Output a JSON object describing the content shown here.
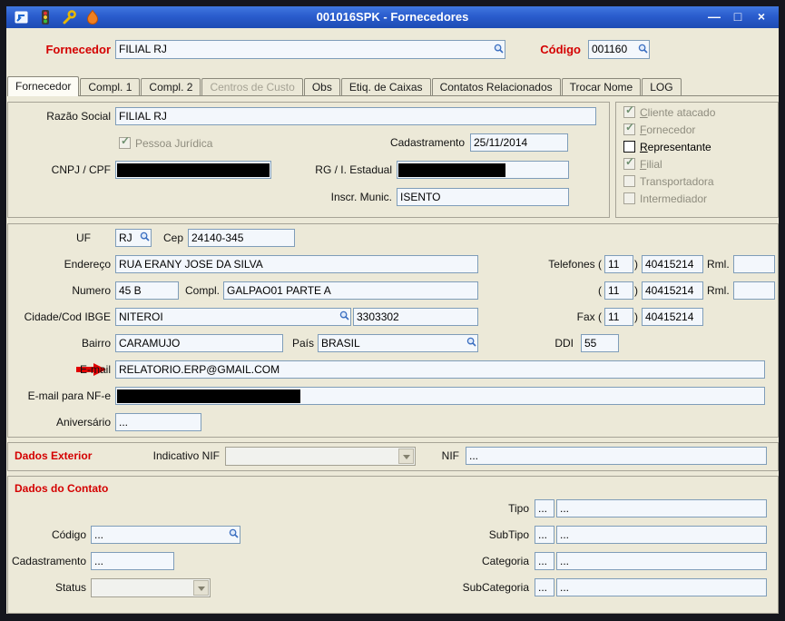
{
  "colors": {
    "titlebar_blue": "#2a5ccd",
    "accent_red": "#d40000",
    "field_bg": "#f3f7fc",
    "window_border": "#15161d",
    "client_bg": "#ece9d8"
  },
  "icons": {
    "titlebar": [
      "export-icon",
      "traffic-light-icon",
      "wrench-icon",
      "flame-icon"
    ],
    "lookup": "magnifier-icon",
    "email_pointer": "red-arrow-icon"
  },
  "window": {
    "title": "001016SPK - Fornecedores",
    "minimize_glyph": "—",
    "maximize_glyph": "□",
    "close_glyph": "×"
  },
  "header": {
    "fornecedor_label": "Fornecedor",
    "fornecedor_value": "FILIAL RJ",
    "codigo_label": "Código",
    "codigo_value": "001160"
  },
  "tabs": [
    "Fornecedor",
    "Compl. 1",
    "Compl. 2",
    "Centros de Custo",
    "Obs",
    "Etiq. de Caixas",
    "Contatos Relacionados",
    "Trocar Nome",
    "LOG"
  ],
  "identificacao": {
    "razao_social_label": "Razão Social",
    "razao_social_value": "FILIAL RJ",
    "pessoa_juridica_label": "Pessoa Jurídica",
    "pessoa_juridica_checked": true,
    "cadastramento_label": "Cadastramento",
    "cadastramento_value": "25/11/2014",
    "cnpj_label": "CNPJ / CPF",
    "cnpj_value_redacted": true,
    "rg_label": "RG / I. Estadual",
    "rg_value_redacted": true,
    "inscr_munic_label": "Inscr. Munic.",
    "inscr_munic_value": "ISENTO"
  },
  "flags": [
    {
      "label": "Cliente atacado",
      "checked": true,
      "enabled": false
    },
    {
      "label": "Fornecedor",
      "checked": true,
      "enabled": false
    },
    {
      "label": "Representante",
      "checked": false,
      "enabled": true
    },
    {
      "label": "Filial",
      "checked": true,
      "enabled": false
    },
    {
      "label": "Transportadora",
      "checked": false,
      "enabled": false
    },
    {
      "label": "Intermediador",
      "checked": false,
      "enabled": false
    }
  ],
  "endereco": {
    "uf_label": "UF",
    "uf_value": "RJ",
    "cep_label": "Cep",
    "cep_value": "24140-345",
    "endereco_label": "Endereço",
    "endereco_value": "RUA ERANY JOSE DA SILVA",
    "telefones_label": "Telefones (",
    "open_paren": "(",
    "close_paren": ")",
    "tel1_ddd": "11",
    "tel1_numero": "40415214",
    "tel1_rml_label": "Rml.",
    "tel1_rml_value": "",
    "tel2_ddd": "11",
    "tel2_numero": "40415214",
    "tel2_rml_label": "Rml.",
    "tel2_rml_value": "",
    "numero_label": "Numero",
    "numero_value": "45 B",
    "compl_label": "Compl.",
    "compl_value": "GALPAO01 PARTE A",
    "cidade_label": "Cidade/Cod IBGE",
    "cidade_value": "NITEROI",
    "cod_ibge_value": "3303302",
    "fax_label": "Fax (",
    "fax_ddd": "11",
    "fax_numero": "40415214",
    "bairro_label": "Bairro",
    "bairro_value": "CARAMUJO",
    "pais_label": "País",
    "pais_value": "BRASIL",
    "ddi_label": "DDI",
    "ddi_value": "55",
    "email_label": "E-mail",
    "email_value": "RELATORIO.ERP@GMAIL.COM",
    "email_nfe_label": "E-mail para NF-e",
    "email_nfe_redacted": true,
    "aniversario_label": "Aniversário",
    "aniversario_value": "..."
  },
  "dados_exterior": {
    "title": "Dados Exterior",
    "indicativo_nif_label": "Indicativo NIF",
    "indicativo_nif_value": "",
    "nif_label": "NIF",
    "nif_value": "..."
  },
  "dados_contato": {
    "title": "Dados do Contato",
    "codigo_label": "Código",
    "codigo_value": "...",
    "cadastramento_label": "Cadastramento",
    "cadastramento_value": "...",
    "status_label": "Status",
    "status_value": "",
    "tipo_label": "Tipo",
    "tipo_code": "...",
    "tipo_value": "...",
    "subtipo_label": "SubTipo",
    "subtipo_code": "...",
    "subtipo_value": "...",
    "categoria_label": "Categoria",
    "categoria_code": "...",
    "categoria_value": "...",
    "subcategoria_label": "SubCategoria",
    "subcategoria_code": "...",
    "subcategoria_value": "..."
  }
}
